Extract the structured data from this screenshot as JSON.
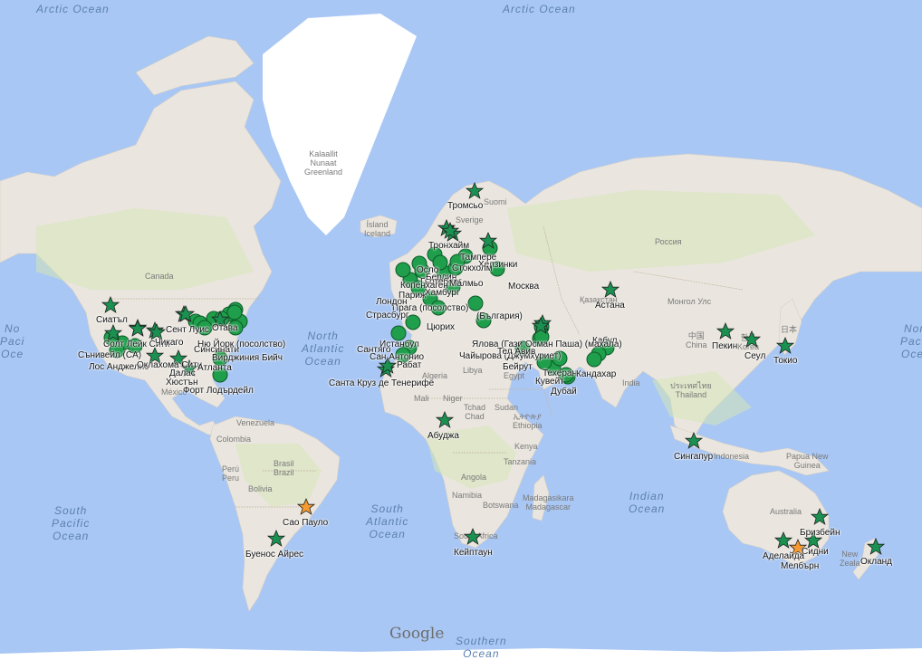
{
  "map": {
    "attribution": "Google",
    "colors": {
      "water": "#a9c7f4",
      "land": "#eae6df",
      "greenland": "#ffffff",
      "vegetation": "#d6e5b7",
      "border": "#c5b5a4",
      "office_marker": "#1f9e4b",
      "star_primary": "#1a9150",
      "star_highlight": "#f79a30"
    },
    "oceans": [
      {
        "id": "arctic-ocean-west",
        "name": "Arctic Ocean"
      },
      {
        "id": "arctic-ocean-east",
        "name": "Arctic Ocean"
      },
      {
        "id": "north-atlantic-ocean",
        "name": "North\nAtlantic\nOcean"
      },
      {
        "id": "south-atlantic-ocean",
        "name": "South\nAtlantic\nOcean"
      },
      {
        "id": "south-pacific-ocean",
        "name": "South\nPacific\nOcean"
      },
      {
        "id": "north-pacific-ocean-east",
        "name": "North\nPacific\nOcean"
      },
      {
        "id": "north-pacific-ocean-west",
        "name": "No\nPaci\nOce"
      },
      {
        "id": "indian-ocean",
        "name": "Indian\nOcean"
      },
      {
        "id": "southern-ocean",
        "name": "Southern\nOcean"
      }
    ],
    "regions": [
      {
        "id": "greenland",
        "name": "Kalaallit\nNunaat\nGreenland"
      },
      {
        "id": "iceland",
        "name": "Ísland\nIceland"
      },
      {
        "id": "canada",
        "name": "Canada"
      },
      {
        "id": "sweden",
        "name": "Sverige"
      },
      {
        "id": "finland",
        "name": "Suomi"
      },
      {
        "id": "russia",
        "name": "Россия"
      },
      {
        "id": "kazakhstan",
        "name": "Қазақстан"
      },
      {
        "id": "mongolia",
        "name": "Монгол Улс"
      },
      {
        "id": "china",
        "name": "中国\nChina"
      },
      {
        "id": "japan",
        "name": "日本"
      },
      {
        "id": "korea",
        "name": "한국\nKorea"
      },
      {
        "id": "india",
        "name": "India"
      },
      {
        "id": "thailand",
        "name": "ประเทศไทย\nThailand"
      },
      {
        "id": "indonesia",
        "name": "Indonesia"
      },
      {
        "id": "papua",
        "name": "Papua New\nGuinea"
      },
      {
        "id": "australia",
        "name": "Australia"
      },
      {
        "id": "nz",
        "name": "New\nZeala"
      },
      {
        "id": "mali",
        "name": "Mali"
      },
      {
        "id": "niger",
        "name": "Niger"
      },
      {
        "id": "chad",
        "name": "Tchad\nChad"
      },
      {
        "id": "sudan",
        "name": "Sudan"
      },
      {
        "id": "ethiopia",
        "name": "ኢትዮጵያ\nEthiopia"
      },
      {
        "id": "kenya",
        "name": "Kenya"
      },
      {
        "id": "tanzania",
        "name": "Tanzania"
      },
      {
        "id": "angola",
        "name": "Angola"
      },
      {
        "id": "namibia",
        "name": "Namibia"
      },
      {
        "id": "botswana",
        "name": "Botswana"
      },
      {
        "id": "madagascar",
        "name": "Madagasikara\nMadagascar"
      },
      {
        "id": "south-africa",
        "name": "South Africa"
      },
      {
        "id": "venezuela",
        "name": "Venezuela"
      },
      {
        "id": "colombia",
        "name": "Colombia"
      },
      {
        "id": "peru",
        "name": "Perú\nPeru"
      },
      {
        "id": "brasil",
        "name": "Brasil\nBrazil"
      },
      {
        "id": "bolivia",
        "name": "Bolivia"
      },
      {
        "id": "mexico",
        "name": "México"
      },
      {
        "id": "algeria",
        "name": "Algeria"
      },
      {
        "id": "libya",
        "name": "Libya"
      },
      {
        "id": "egypt",
        "name": "Egypt"
      }
    ],
    "cities": [
      {
        "id": "tromso",
        "name": "Тромсьо",
        "type": "star"
      },
      {
        "id": "trondheim",
        "name": "Тронхайм",
        "type": "star"
      },
      {
        "id": "tampere",
        "name": "Тампере",
        "type": "star"
      },
      {
        "id": "helsinki",
        "name": "Хелзинки",
        "type": "dot"
      },
      {
        "id": "stockholm",
        "name": "Стокхолм",
        "type": "dot"
      },
      {
        "id": "moscow",
        "name": "Москва",
        "type": "dot"
      },
      {
        "id": "astana",
        "name": "Астана",
        "type": "star"
      },
      {
        "id": "beijing",
        "name": "Пекин",
        "type": "star"
      },
      {
        "id": "seoul",
        "name": "Сеул",
        "type": "star"
      },
      {
        "id": "tokyo",
        "name": "Токио",
        "type": "star"
      },
      {
        "id": "seattle",
        "name": "Сиатъл",
        "type": "star"
      },
      {
        "id": "sunnyvale",
        "name": "Сънивейл (CA)",
        "type": "dot"
      },
      {
        "id": "los-angeles",
        "name": "Лос Анджелис",
        "type": "dot"
      },
      {
        "id": "salt-lake",
        "name": "Солт Лейк Сити",
        "type": "star"
      },
      {
        "id": "oklahoma",
        "name": "Оклахома Сити",
        "type": "star"
      },
      {
        "id": "dallas",
        "name": "Далас",
        "type": "star"
      },
      {
        "id": "houston",
        "name": "Хюстън",
        "type": "star"
      },
      {
        "id": "atlanta",
        "name": "Атланта",
        "type": "dot"
      },
      {
        "id": "fort-lauderdale",
        "name": "Форт Лодърдейл",
        "type": "dot"
      },
      {
        "id": "virginia-beach",
        "name": "Вирджиния Бийч",
        "type": "dot"
      },
      {
        "id": "chicago",
        "name": "Чикаго",
        "type": "star"
      },
      {
        "id": "ottawa",
        "name": "Отава",
        "type": "dot"
      },
      {
        "id": "cincinnati",
        "name": "Синсинати",
        "type": "dot"
      },
      {
        "id": "st-louis",
        "name": "Сент Луис",
        "type": "star"
      },
      {
        "id": "new-york",
        "name": "Ню Йорк (посолство)",
        "type": "dot"
      },
      {
        "id": "santa-cruz",
        "name": "Санта Круз де Тенерифе",
        "type": "star"
      },
      {
        "id": "rabat",
        "name": "Рабат",
        "type": "star"
      },
      {
        "id": "abuja",
        "name": "Абуджа",
        "type": "star"
      },
      {
        "id": "cape-town",
        "name": "Кейптаун",
        "type": "star"
      },
      {
        "id": "istanbul",
        "name": "Истанбул",
        "type": "dot"
      },
      {
        "id": "beirut",
        "name": "Бейрут",
        "type": "dot"
      },
      {
        "id": "tehran",
        "name": "Техеран",
        "type": "dot"
      },
      {
        "id": "kuwait",
        "name": "Кувейт",
        "type": "dot"
      },
      {
        "id": "dubai",
        "name": "Дубай",
        "type": "dot"
      },
      {
        "id": "kabul",
        "name": "Кабул",
        "type": "dot"
      },
      {
        "id": "kandahar",
        "name": "Кандахар",
        "type": "dot"
      },
      {
        "id": "singapore",
        "name": "Сингапур",
        "type": "star"
      },
      {
        "id": "brisbane",
        "name": "Бризбейн",
        "type": "star"
      },
      {
        "id": "sydney",
        "name": "Сидни",
        "type": "star-orange"
      },
      {
        "id": "adelaide",
        "name": "Аделайда",
        "type": "star"
      },
      {
        "id": "melbourne",
        "name": "Мелбърн",
        "type": "star"
      },
      {
        "id": "auckland",
        "name": "Окланд",
        "type": "star"
      },
      {
        "id": "sao-paulo",
        "name": "Сао Пауло",
        "type": "star-orange"
      },
      {
        "id": "buenos-aires",
        "name": "Буенос Айрес",
        "type": "star"
      },
      {
        "id": "prague",
        "name": "Прага (посолство)",
        "type": "dot"
      },
      {
        "id": "strasbourg",
        "name": "Страсбург",
        "type": "dot"
      },
      {
        "id": "paris",
        "name": "Париж",
        "type": "dot"
      },
      {
        "id": "zurich",
        "name": "Цюрих",
        "type": "dot"
      },
      {
        "id": "london",
        "name": "Лондон",
        "type": "dot"
      },
      {
        "id": "hamburg",
        "name": "Хамбург",
        "type": "dot"
      },
      {
        "id": "berlin",
        "name": "Берлин",
        "type": "dot"
      },
      {
        "id": "goteborg",
        "name": "Гьотеборг",
        "type": "dot"
      },
      {
        "id": "copenhagen",
        "name": "Копенхаген",
        "type": "dot"
      },
      {
        "id": "malmo",
        "name": "Малмьо",
        "type": "dot"
      },
      {
        "id": "oslo",
        "name": "Осло",
        "type": "dot"
      },
      {
        "id": "yalova",
        "name": "Ялова (Гази Осман Паша) (махала)",
        "type": "dot"
      },
      {
        "id": "djumuriet",
        "name": "Чайырова (Джумхуриет)",
        "type": "dot"
      },
      {
        "id": "sofia",
        "name": "(България)",
        "type": "dot"
      },
      {
        "id": "santiago",
        "name": "Сантяго",
        "type": "dot"
      },
      {
        "id": "san-antonio",
        "name": "Сан Антонио",
        "type": "dot"
      },
      {
        "id": "tel-aviv",
        "name": "Тел Авив",
        "type": "dot"
      }
    ]
  }
}
